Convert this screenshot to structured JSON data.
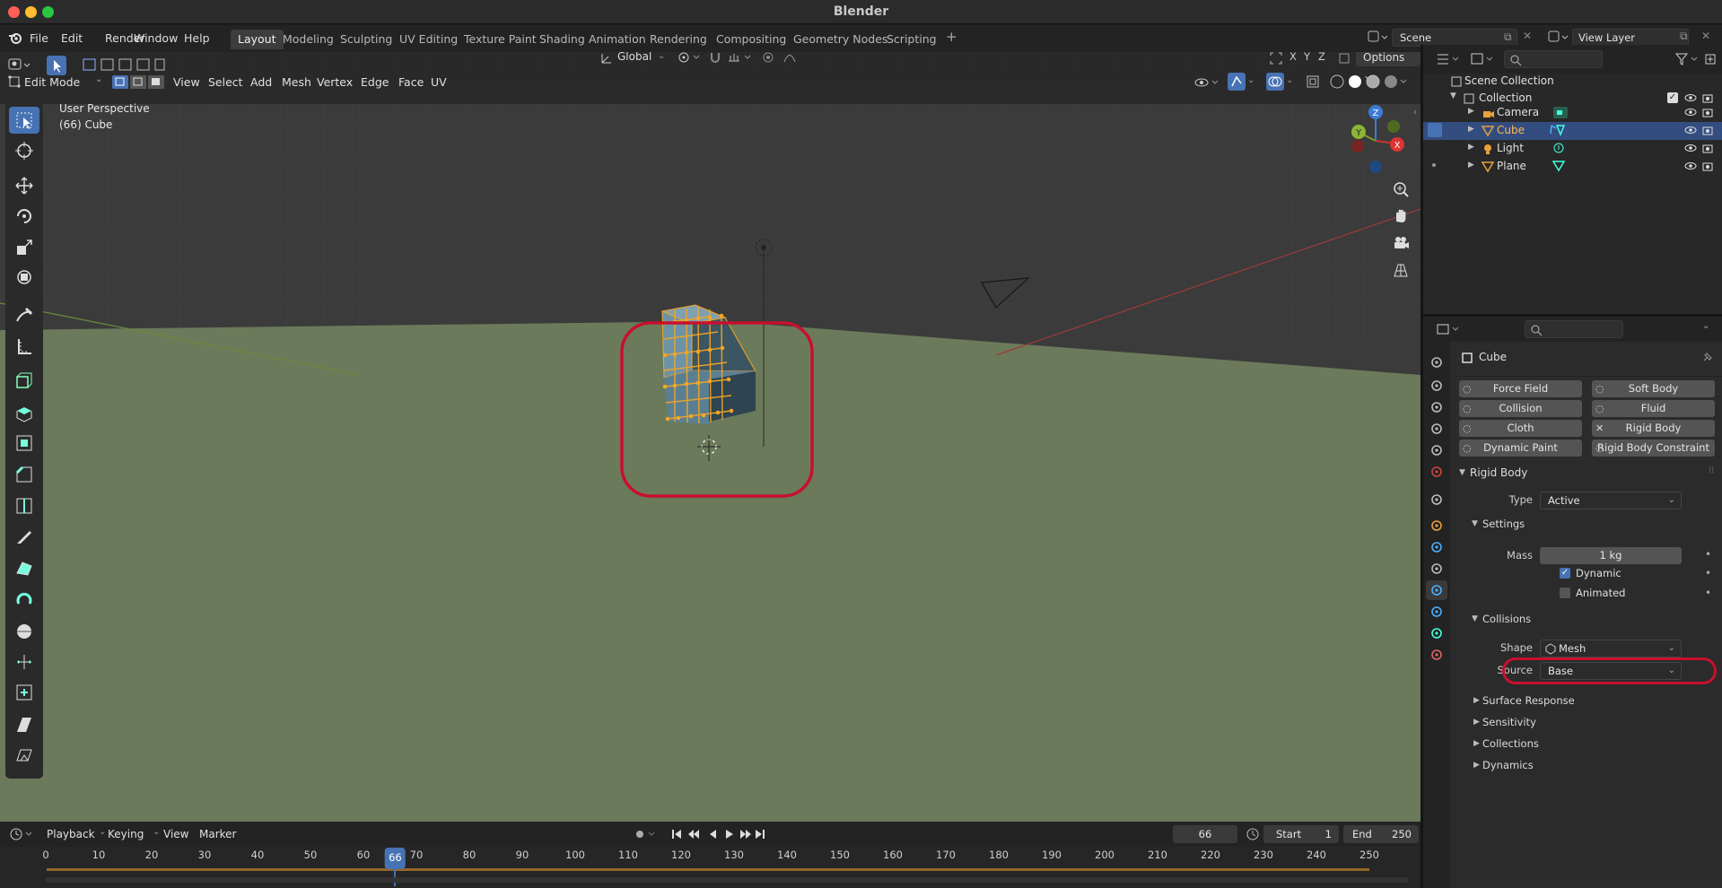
{
  "window": {
    "title": "Blender"
  },
  "menus": [
    "File",
    "Edit",
    "Render",
    "Window",
    "Help"
  ],
  "workspaces": [
    "Layout",
    "Modeling",
    "Sculpting",
    "UV Editing",
    "Texture Paint",
    "Shading",
    "Animation",
    "Rendering",
    "Compositing",
    "Geometry Nodes",
    "Scripting"
  ],
  "active_workspace": "Layout",
  "scene": {
    "name": "Scene",
    "view_layer": "View Layer"
  },
  "viewport_header": {
    "mode": "Edit Mode",
    "menus": [
      "View",
      "Select",
      "Add",
      "Mesh",
      "Vertex",
      "Edge",
      "Face",
      "UV"
    ],
    "orientation": "Global",
    "options": "Options",
    "axes": [
      "X",
      "Y",
      "Z"
    ]
  },
  "viewport": {
    "perspective": "User Perspective",
    "object_info": "(66) Cube"
  },
  "gizmo": {
    "x": "X",
    "y": "Y",
    "z": "Z"
  },
  "outliner": {
    "root": "Scene Collection",
    "collection": "Collection",
    "items": [
      {
        "label": "Camera",
        "selected": false
      },
      {
        "label": "Cube",
        "selected": true
      },
      {
        "label": "Light",
        "selected": false
      },
      {
        "label": "Plane",
        "selected": false
      }
    ]
  },
  "properties": {
    "object_name": "Cube",
    "physics_buttons": [
      "Force Field",
      "Soft Body",
      "Collision",
      "Fluid",
      "Cloth",
      "Rigid Body",
      "Dynamic Paint",
      "Rigid Body Constraint"
    ],
    "rigid_body": {
      "header": "Rigid Body",
      "type_label": "Type",
      "type_value": "Active",
      "settings_header": "Settings",
      "mass_label": "Mass",
      "mass_value": "1 kg",
      "dynamic_label": "Dynamic",
      "dynamic_checked": true,
      "animated_label": "Animated",
      "animated_checked": false,
      "collisions_header": "Collisions",
      "shape_label": "Shape",
      "shape_value": "Mesh",
      "source_label": "Source",
      "source_value": "Base",
      "subpanels": [
        "Surface Response",
        "Sensitivity",
        "Collections",
        "Dynamics"
      ]
    }
  },
  "timeline": {
    "menus": [
      "Playback",
      "Keying",
      "View",
      "Marker"
    ],
    "current_frame": "66",
    "start_label": "Start",
    "start": "1",
    "end_label": "End",
    "end": "250",
    "ticks": [
      "0",
      "10",
      "20",
      "30",
      "40",
      "50",
      "60",
      "70",
      "80",
      "90",
      "100",
      "110",
      "120",
      "130",
      "140",
      "150",
      "160",
      "170",
      "180",
      "190",
      "200",
      "210",
      "220",
      "230",
      "240",
      "250"
    ],
    "playhead": "66"
  },
  "colors": {
    "accent_blue": "#4772b3",
    "highlight_red": "#c8102e",
    "selected_orange": "#f5a623",
    "ground": "#6b7a5a"
  }
}
